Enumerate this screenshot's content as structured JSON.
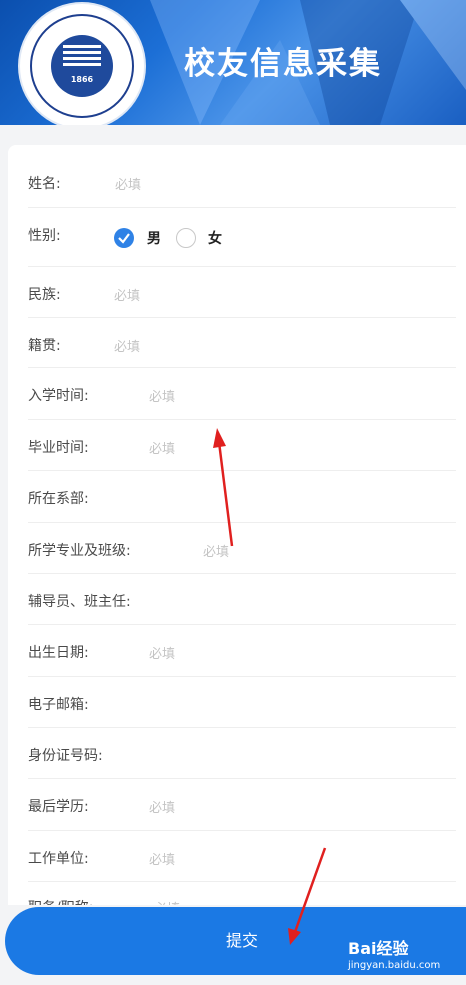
{
  "header": {
    "title": "校友信息采集",
    "logo_year": "1866"
  },
  "form": {
    "name": {
      "label": "姓名:",
      "placeholder": "必填"
    },
    "gender": {
      "label": "性别:",
      "options": [
        "男",
        "女"
      ],
      "selected": "男"
    },
    "ethnicity": {
      "label": "民族:",
      "placeholder": "必填"
    },
    "native_place": {
      "label": "籍贯:",
      "placeholder": "必填"
    },
    "enroll_time": {
      "label": "入学时间:",
      "placeholder": "必填"
    },
    "graduate_time": {
      "label": "毕业时间:",
      "placeholder": "必填"
    },
    "department": {
      "label": "所在系部:",
      "placeholder": ""
    },
    "major_class": {
      "label": "所学专业及班级:",
      "placeholder": "必填"
    },
    "counselor": {
      "label": "辅导员、班主任:",
      "placeholder": ""
    },
    "birth_date": {
      "label": "出生日期:",
      "placeholder": "必填"
    },
    "email": {
      "label": "电子邮箱:",
      "placeholder": ""
    },
    "id_number": {
      "label": "身份证号码:",
      "placeholder": ""
    },
    "education": {
      "label": "最后学历:",
      "placeholder": "必填"
    },
    "employer": {
      "label": "工作单位:",
      "placeholder": "必填"
    },
    "position": {
      "label": "职务/职称:",
      "placeholder": "必填"
    }
  },
  "submit_label": "提交",
  "watermark": {
    "brand": "Bai经验",
    "url": "jingyan.baidu.com"
  },
  "colors": {
    "accent": "#1b79e4",
    "banner": "#1c6fd6",
    "annotation_arrow": "#e0201f"
  }
}
